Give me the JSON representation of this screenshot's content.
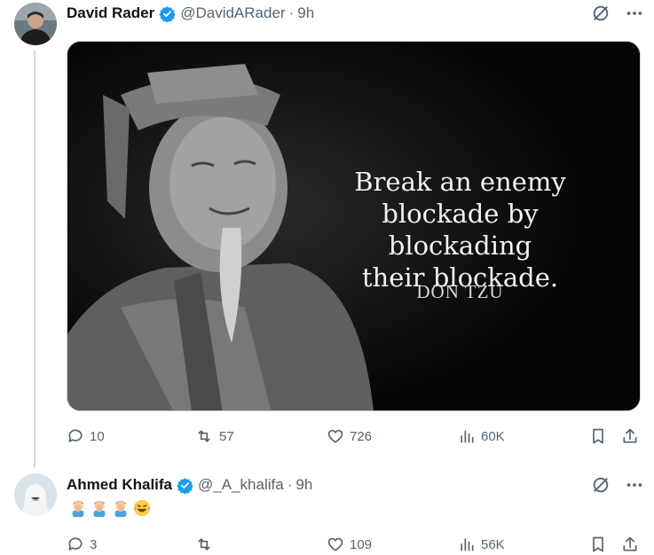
{
  "tweet1": {
    "name": "David Rader",
    "handle": "@DavidARader",
    "dot": "·",
    "time": "9h",
    "image": {
      "quote_lines": [
        "Break an enemy",
        "blockade by blockading",
        "their blockade."
      ],
      "attribution": "DON TZU"
    },
    "actions": {
      "replies": "10",
      "reposts": "57",
      "likes": "726",
      "views": "60K"
    }
  },
  "tweet2": {
    "name": "Ahmed Khalifa",
    "handle": "@_A_khalifa",
    "dot": "·",
    "time": "9h",
    "actions": {
      "replies": "3",
      "reposts": "",
      "likes": "109",
      "views": "56K"
    }
  },
  "colors": {
    "verified": "#1d9bf0",
    "muted": "#536471",
    "divider": "#cfd9de"
  },
  "icons": [
    "verified-badge-icon",
    "grok-icon",
    "more-icon",
    "reply-icon",
    "repost-icon",
    "like-icon",
    "views-icon",
    "bookmark-icon",
    "share-icon",
    "facepalm-emoji",
    "laughing-emoji"
  ]
}
